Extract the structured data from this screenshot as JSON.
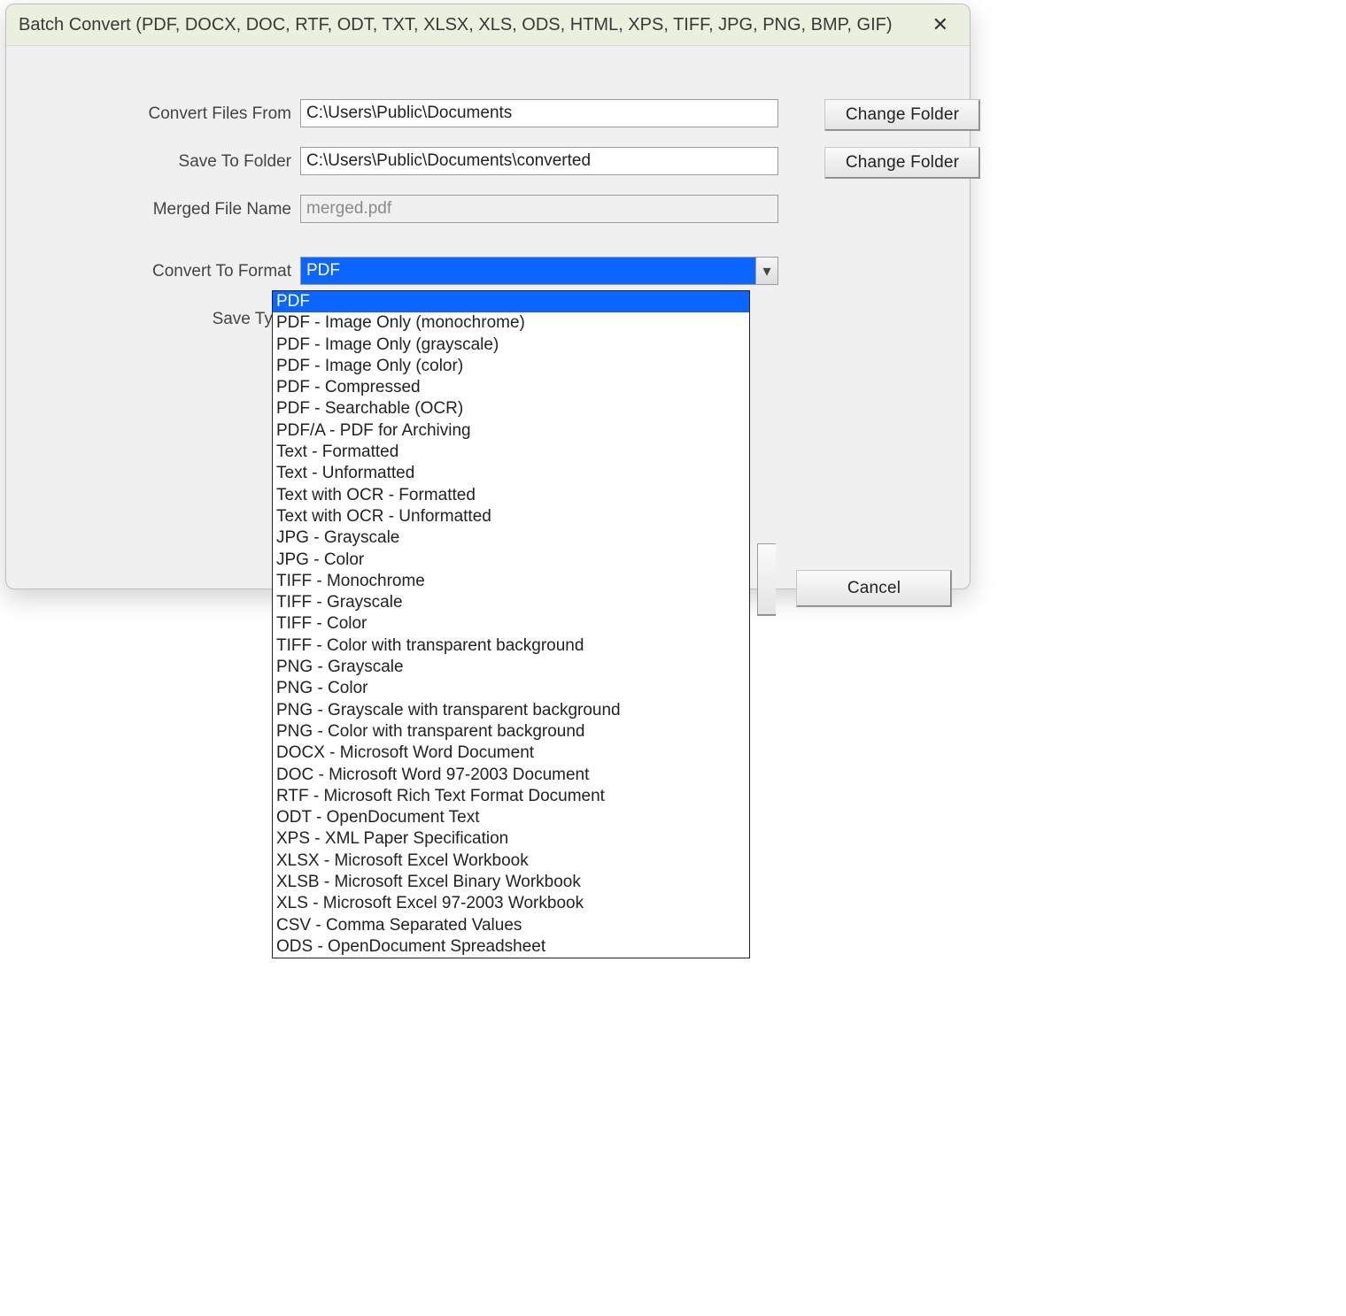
{
  "window": {
    "title": "Batch Convert (PDF, DOCX, DOC, RTF, ODT, TXT, XLSX, XLS, ODS, HTML, XPS, TIFF, JPG, PNG, BMP, GIF)"
  },
  "labels": {
    "convert_from": "Convert Files From",
    "save_to": "Save To Folder",
    "merged_name": "Merged File Name",
    "convert_format": "Convert To Format",
    "save_type": "Save Type"
  },
  "fields": {
    "convert_from": "C:\\Users\\Public\\Documents",
    "save_to": "C:\\Users\\Public\\Documents\\converted",
    "merged_name": "merged.pdf",
    "convert_format_selected": "PDF"
  },
  "buttons": {
    "change_folder": "Change Folder",
    "cancel": "Cancel"
  },
  "format_options": [
    "PDF",
    "PDF - Image Only (monochrome)",
    "PDF - Image Only (grayscale)",
    "PDF - Image Only (color)",
    "PDF - Compressed",
    "PDF - Searchable (OCR)",
    "PDF/A - PDF for Archiving",
    "Text - Formatted",
    "Text - Unformatted",
    "Text with OCR - Formatted",
    "Text with OCR - Unformatted",
    "JPG - Grayscale",
    "JPG - Color",
    "TIFF - Monochrome",
    "TIFF - Grayscale",
    "TIFF - Color",
    "TIFF - Color with transparent background",
    "PNG - Grayscale",
    "PNG - Color",
    "PNG - Grayscale with transparent background",
    "PNG - Color with transparent background",
    "DOCX - Microsoft Word Document",
    "DOC - Microsoft Word 97-2003 Document",
    "RTF - Microsoft Rich Text Format Document",
    "ODT - OpenDocument Text",
    "XPS - XML Paper Specification",
    "XLSX - Microsoft Excel Workbook",
    "XLSB - Microsoft Excel Binary Workbook",
    "XLS - Microsoft Excel 97-2003 Workbook",
    "CSV - Comma Separated Values",
    "ODS - OpenDocument Spreadsheet"
  ],
  "highlighted_option_index": 0
}
